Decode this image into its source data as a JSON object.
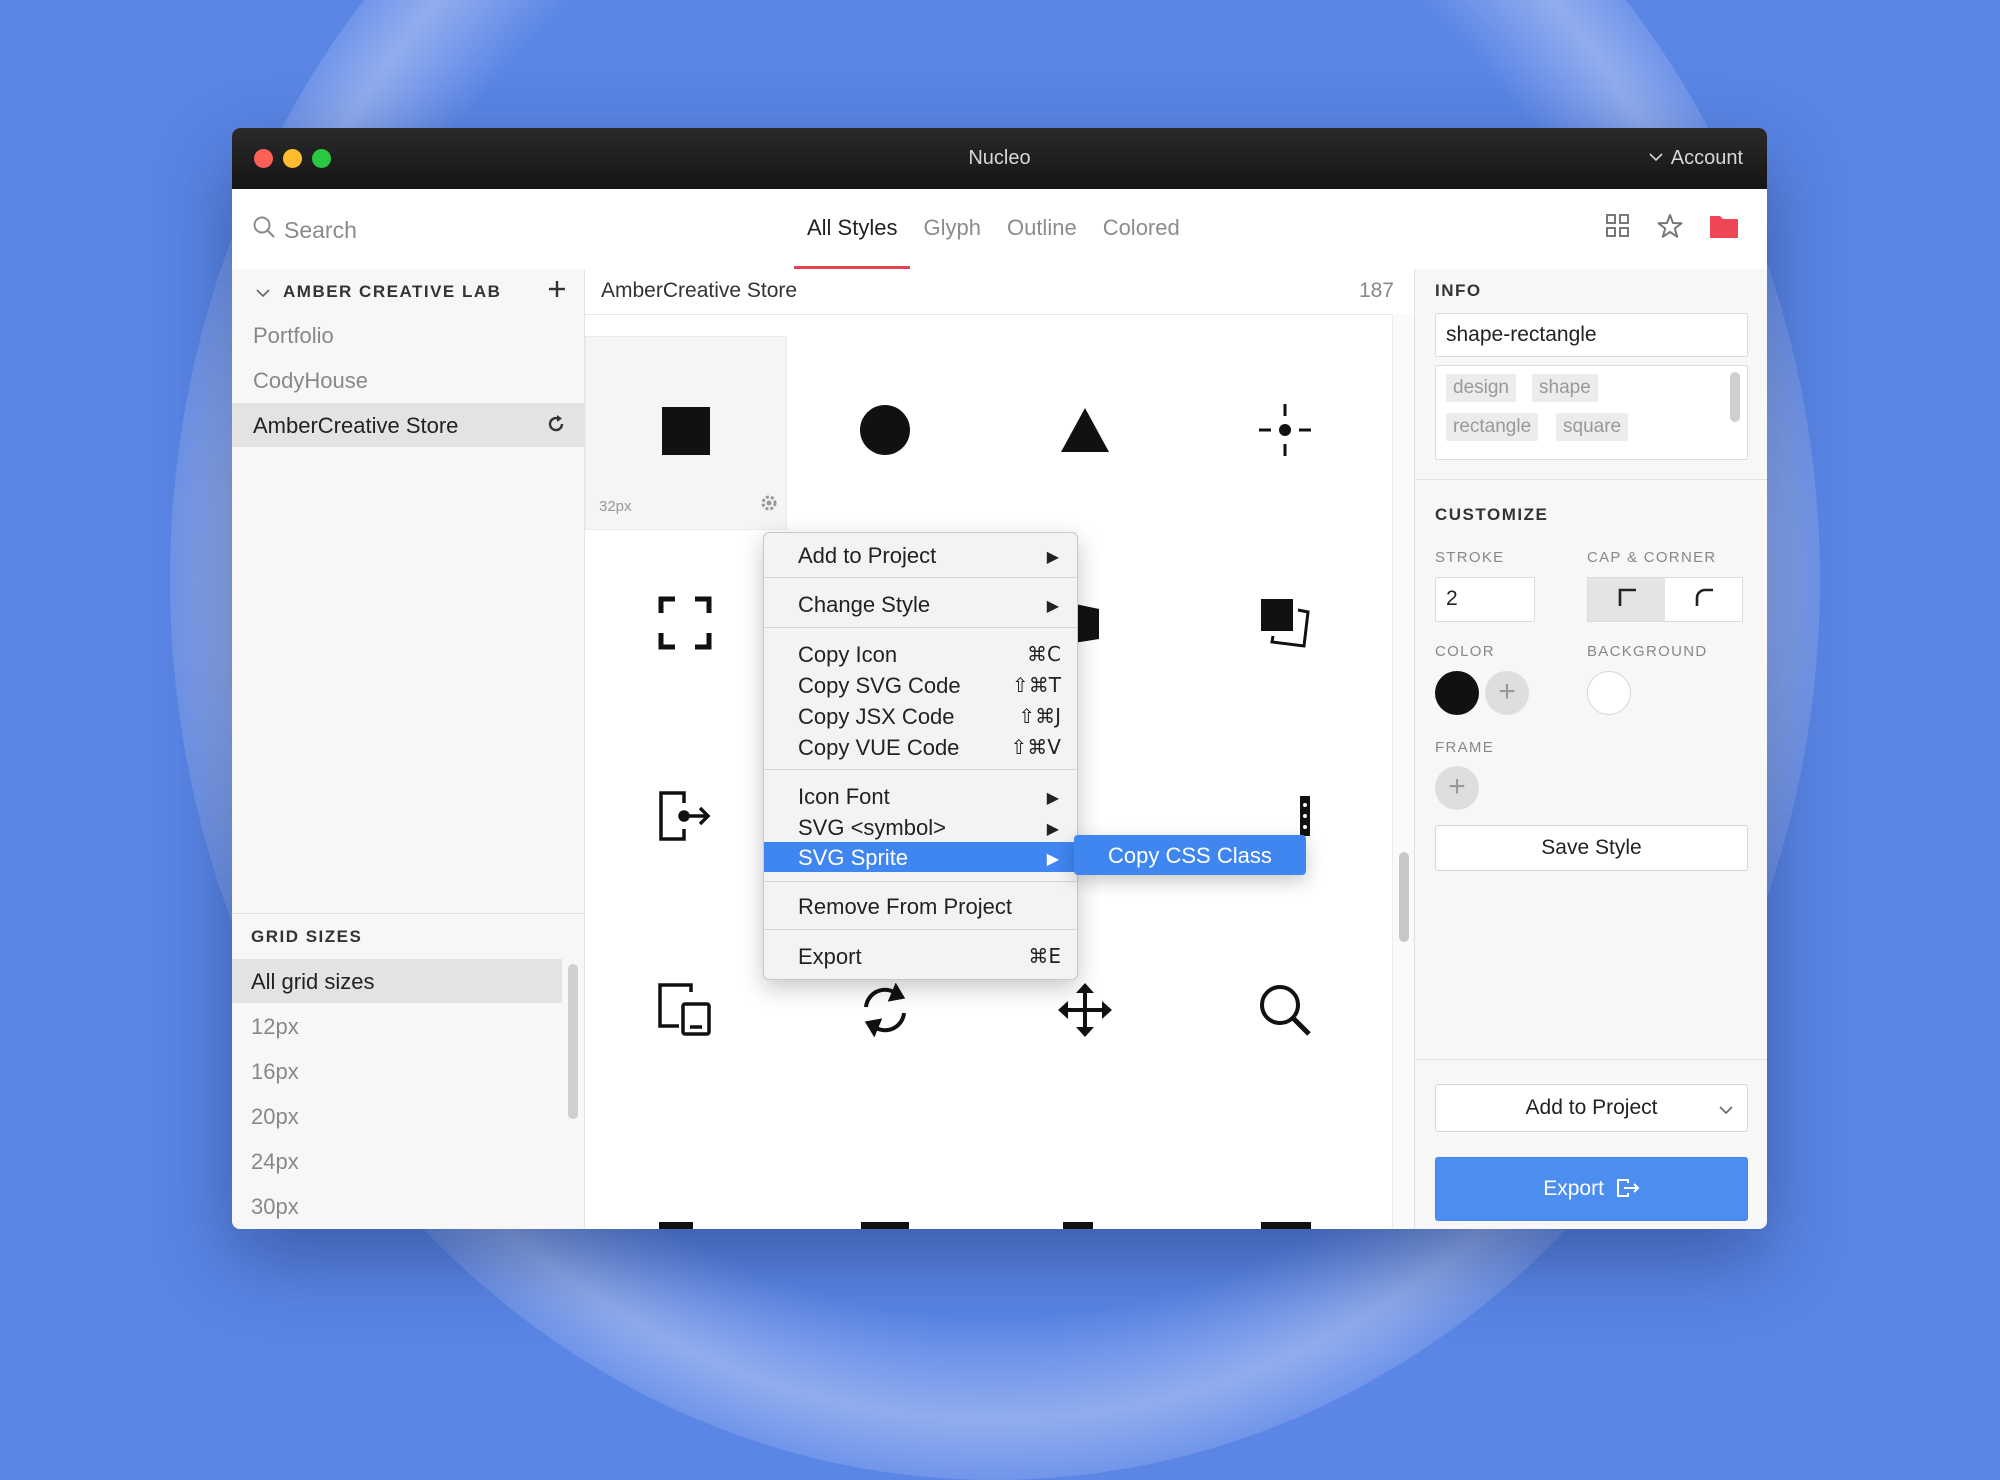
{
  "window": {
    "title": "Nucleo",
    "account_label": "Account"
  },
  "toolbar": {
    "search_placeholder": "Search",
    "tabs": [
      {
        "label": "All Styles",
        "active": true
      },
      {
        "label": "Glyph"
      },
      {
        "label": "Outline"
      },
      {
        "label": "Colored"
      }
    ],
    "icons": [
      "grid-view-icon",
      "star-icon",
      "folder-icon"
    ]
  },
  "sidebar": {
    "library_header": "AMBER CREATIVE LAB",
    "items": [
      {
        "label": "Portfolio"
      },
      {
        "label": "CodyHouse"
      },
      {
        "label": "AmberCreative Store",
        "active": true
      }
    ],
    "grid_sizes_header": "GRID SIZES",
    "grid_sizes": [
      {
        "label": "All grid sizes",
        "active": true
      },
      {
        "label": "12px"
      },
      {
        "label": "16px"
      },
      {
        "label": "20px"
      },
      {
        "label": "24px"
      },
      {
        "label": "30px"
      }
    ]
  },
  "content": {
    "collection_name": "AmberCreative Store",
    "count": "187",
    "selected_size": "32px",
    "icons": [
      "square-icon",
      "circle-icon",
      "triangle-icon",
      "crosshair-icon",
      "expand-icon",
      "shape-icon",
      "hide",
      "layers-icon",
      "logout-icon",
      "hide",
      "hide",
      "more-icon",
      "devices-icon",
      "refresh-icon",
      "move-icon",
      "search-icon"
    ]
  },
  "context_menu": {
    "add_to_project": "Add to Project",
    "change_style": "Change Style",
    "copy_icon": "Copy Icon",
    "copy_icon_key": "⌘C",
    "copy_svg": "Copy SVG Code",
    "copy_svg_key": "⇧⌘T",
    "copy_jsx": "Copy JSX Code",
    "copy_jsx_key": "⇧⌘J",
    "copy_vue": "Copy VUE Code",
    "copy_vue_key": "⇧⌘V",
    "icon_font": "Icon Font",
    "svg_symbol": "SVG <symbol>",
    "svg_sprite": "SVG Sprite",
    "remove": "Remove From Project",
    "export": "Export",
    "export_key": "⌘E",
    "submenu_item": "Copy CSS Class"
  },
  "info_panel": {
    "header": "INFO",
    "icon_name": "shape-rectangle",
    "tags": [
      "design",
      "shape",
      "rectangle",
      "square"
    ],
    "customize_header": "CUSTOMIZE",
    "stroke_label": "STROKE",
    "stroke_value": "2",
    "cap_corner_label": "CAP & CORNER",
    "color_label": "COLOR",
    "background_label": "BACKGROUND",
    "frame_label": "FRAME",
    "save_style": "Save Style",
    "add_to_project": "Add to Project",
    "export": "Export"
  },
  "colors": {
    "accent_red": "#e8414f",
    "export_blue": "#4c8ef0",
    "menu_highlight": "#3f86f1",
    "icon_color": "#111111"
  }
}
